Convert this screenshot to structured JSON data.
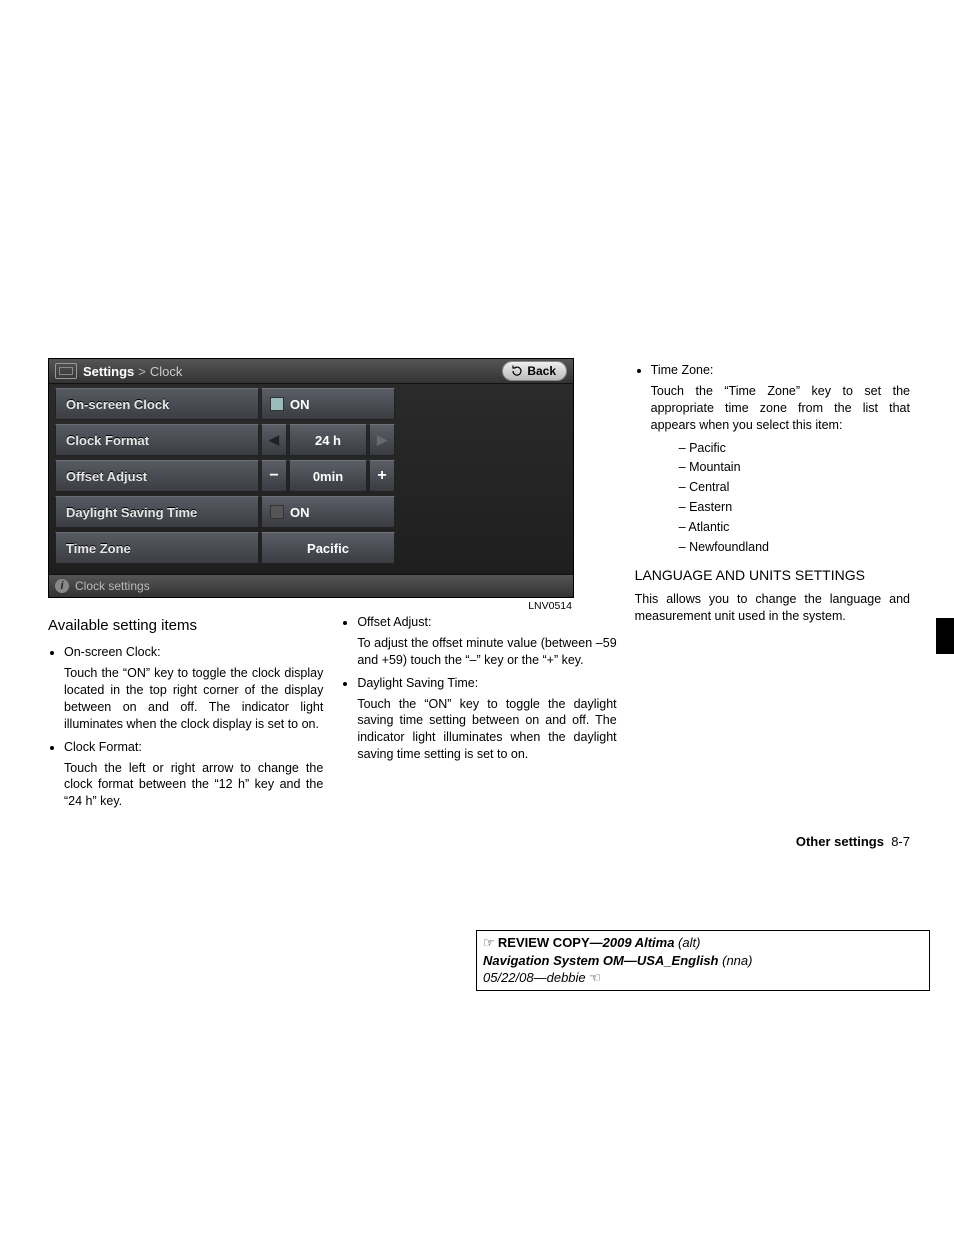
{
  "screenshot": {
    "breadcrumb_root": "Settings",
    "breadcrumb_child": "Clock",
    "back_label": "Back",
    "rows": {
      "onscreen": {
        "label": "On-screen Clock",
        "value": "ON"
      },
      "format": {
        "label": "Clock Format",
        "value": "24 h"
      },
      "offset": {
        "label": "Offset Adjust",
        "value": "0min"
      },
      "dst": {
        "label": "Daylight Saving Time",
        "value": "ON"
      },
      "tz": {
        "label": "Time Zone",
        "value": "Pacific"
      }
    },
    "footer": "Clock settings",
    "figure_code": "LNV0514"
  },
  "col1": {
    "heading": "Available setting items",
    "items": [
      {
        "title": "On-screen Clock:",
        "body": "Touch the “ON” key to toggle the clock display located in the top right corner of the display between on and off. The indicator light illuminates when the clock display is set to on."
      },
      {
        "title": "Clock Format:",
        "body": "Touch the left or right arrow to change the clock format between the “12 h” key and the “24 h” key."
      }
    ]
  },
  "col2": {
    "items": [
      {
        "title": "Offset Adjust:",
        "body": "To adjust the offset minute value (between –59 and +59) touch the “–” key or the “+” key."
      },
      {
        "title": "Daylight Saving Time:",
        "body": "Touch the “ON” key to toggle the daylight saving time setting between on and off. The indicator light illuminates when the daylight saving time setting is set to on."
      }
    ]
  },
  "col3": {
    "tz_title": "Time Zone:",
    "tz_body": "Touch the “Time Zone” key to set the appropriate time zone from the list that appears when you select this item:",
    "tz_list": [
      "Pacific",
      "Mountain",
      "Central",
      "Eastern",
      "Atlantic",
      "Newfoundland"
    ],
    "lang_heading": "LANGUAGE AND UNITS SETTINGS",
    "lang_body": "This allows you to change the language and measurement unit used in the system."
  },
  "footer": {
    "section": "Other settings",
    "page": "8-7"
  },
  "review": {
    "line1a": "REVIEW COPY—",
    "line1b": "2009 Altima",
    "line1c": " (alt)",
    "line2a": "Navigation System OM—USA_English",
    "line2b": " (nna)",
    "line3": "05/22/08—debbie"
  }
}
